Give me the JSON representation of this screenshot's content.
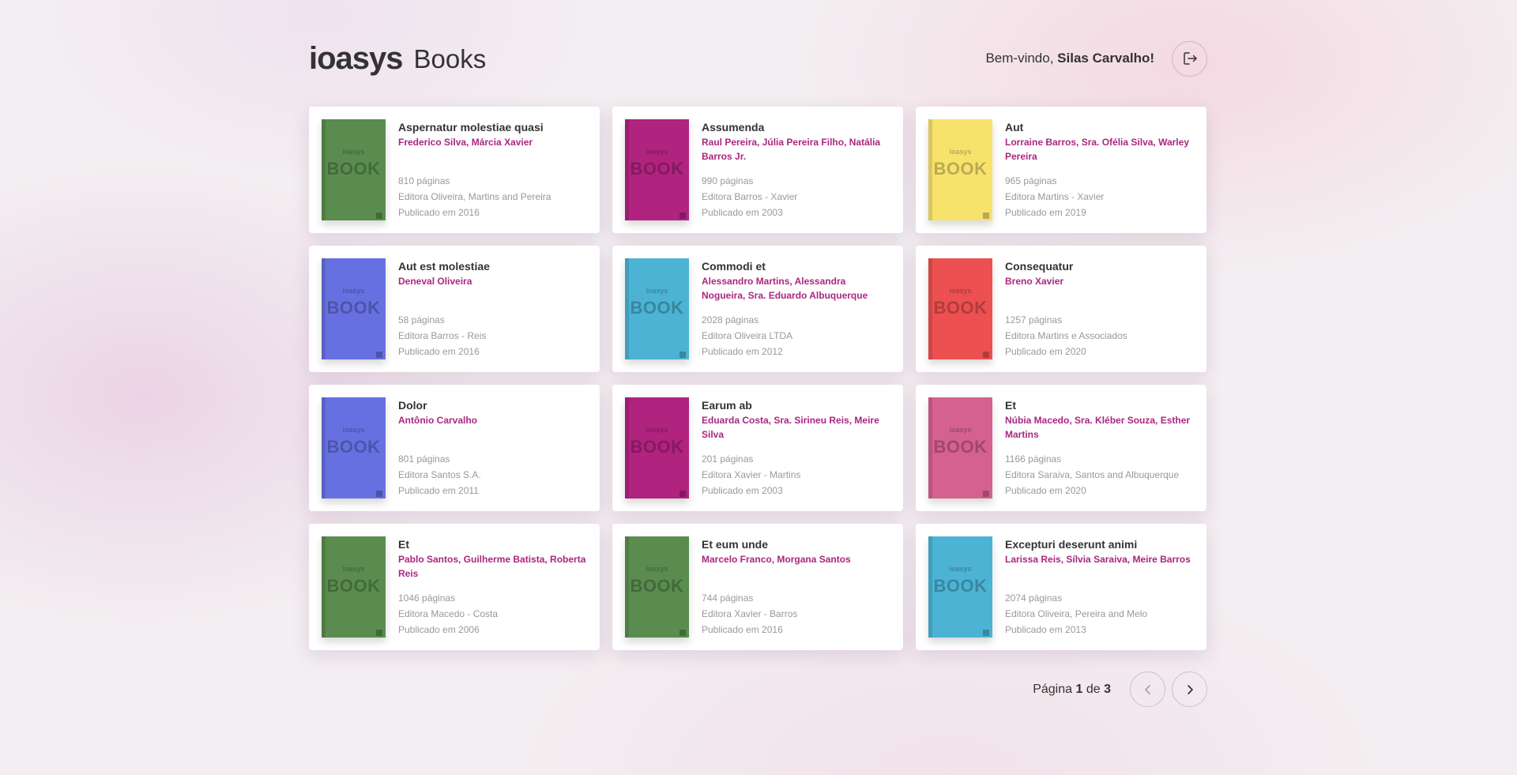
{
  "header": {
    "brand": "ioasys",
    "title": "Books",
    "welcome_prefix": "Bem-vindo,",
    "user_name": "Silas Carvalho!",
    "logout_icon": "logout-icon"
  },
  "cover": {
    "brand": "ioasys",
    "word": "BOOK"
  },
  "books": [
    {
      "title": "Aspernatur molestiae quasi",
      "authors": "Frederico Silva, Márcia Xavier",
      "pages": "810 páginas",
      "publisher": "Editora Oliveira, Martins and Pereira",
      "published": "Publicado em 2016",
      "cover_color": "#5a8c4f"
    },
    {
      "title": "Assumenda",
      "authors": "Raul Pereira, Júlia Pereira Filho, Natália Barros Jr.",
      "pages": "990 páginas",
      "publisher": "Editora Barros - Xavier",
      "published": "Publicado em 2003",
      "cover_color": "#b0237f"
    },
    {
      "title": "Aut",
      "authors": "Lorraine Barros, Sra. Ofélia Silva, Warley Pereira",
      "pages": "965 páginas",
      "publisher": "Editora Martins - Xavier",
      "published": "Publicado em 2019",
      "cover_color": "#f7e36c"
    },
    {
      "title": "Aut est molestiae",
      "authors": "Deneval Oliveira",
      "pages": "58 páginas",
      "publisher": "Editora Barros - Reis",
      "published": "Publicado em 2016",
      "cover_color": "#6770e0"
    },
    {
      "title": "Commodi et",
      "authors": "Alessandro Martins, Alessandra Nogueira, Sra. Eduardo Albuquerque",
      "pages": "2028 páginas",
      "publisher": "Editora Oliveira LTDA",
      "published": "Publicado em 2012",
      "cover_color": "#4cb3d4"
    },
    {
      "title": "Consequatur",
      "authors": "Breno Xavier",
      "pages": "1257 páginas",
      "publisher": "Editora Martins e Associados",
      "published": "Publicado em 2020",
      "cover_color": "#ec5050"
    },
    {
      "title": "Dolor",
      "authors": "Antônio Carvalho",
      "pages": "801 páginas",
      "publisher": "Editora Santos S.A.",
      "published": "Publicado em 2011",
      "cover_color": "#6770e0"
    },
    {
      "title": "Earum ab",
      "authors": "Eduarda Costa, Sra. Sirineu Reis, Meire Silva",
      "pages": "201 páginas",
      "publisher": "Editora Xavier - Martins",
      "published": "Publicado em 2003",
      "cover_color": "#b0237f"
    },
    {
      "title": "Et",
      "authors": "Núbia Macedo, Sra. Kléber Souza, Esther Martins",
      "pages": "1166 páginas",
      "publisher": "Editora Saraiva, Santos and Albuquerque",
      "published": "Publicado em 2020",
      "cover_color": "#d4618e"
    },
    {
      "title": "Et",
      "authors": "Pablo Santos, Guilherme Batista, Roberta Reis",
      "pages": "1046 páginas",
      "publisher": "Editora Macedo - Costa",
      "published": "Publicado em 2006",
      "cover_color": "#5a8c4f"
    },
    {
      "title": "Et eum unde",
      "authors": "Marcelo Franco, Morgana Santos",
      "pages": "744 páginas",
      "publisher": "Editora Xavier - Barros",
      "published": "Publicado em 2016",
      "cover_color": "#5a8c4f"
    },
    {
      "title": "Excepturi deserunt animi",
      "authors": "Larissa Reis, Sílvia Saraiva, Meire Barros",
      "pages": "2074 páginas",
      "publisher": "Editora Oliveira, Pereira and Melo",
      "published": "Publicado em 2013",
      "cover_color": "#4cb3d4"
    }
  ],
  "pagination": {
    "prefix": "Página",
    "current": "1",
    "separator": "de",
    "total": "3",
    "prev_icon": "chevron-left-icon",
    "next_icon": "chevron-right-icon"
  },
  "colors": {
    "accent": "#ab2680",
    "text": "#333333",
    "muted": "#999999"
  }
}
